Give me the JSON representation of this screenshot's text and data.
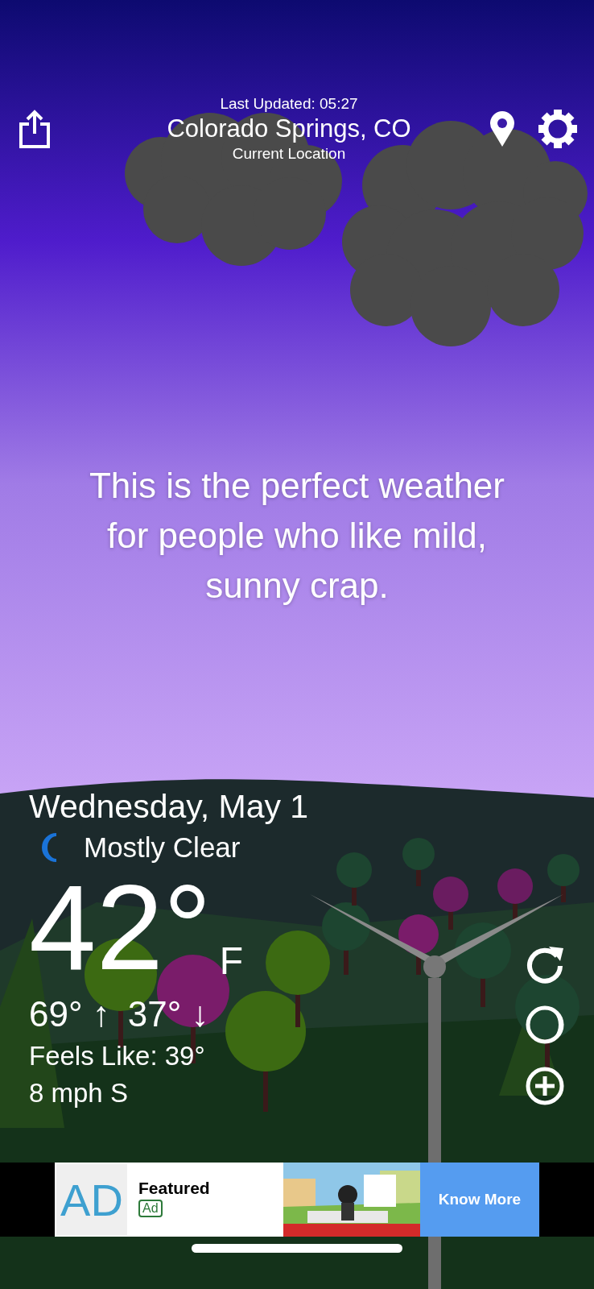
{
  "header": {
    "last_updated": "Last Updated: 05:27",
    "location": "Colorado Springs, CO",
    "subtitle": "Current Location"
  },
  "quote": "This is the perfect weather for people who like mild, sunny crap.",
  "current": {
    "date": "Wednesday, May 1",
    "condition": "Mostly Clear",
    "temperature": "42°",
    "unit": "F",
    "high": "69° ↑",
    "low": "37° ↓",
    "feels_like": "Feels Like: 39°",
    "wind": "8 mph S"
  },
  "ad": {
    "logo": "AD",
    "title": "Featured",
    "badge": "Ad",
    "button": "Know More"
  }
}
